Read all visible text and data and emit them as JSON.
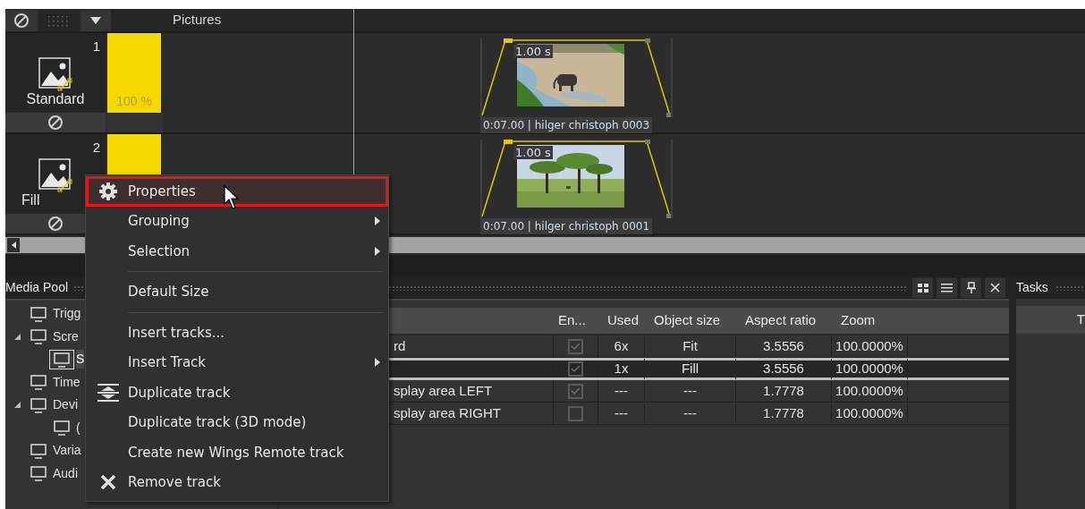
{
  "timeline": {
    "layer_name": "Pictures",
    "tracks": [
      {
        "number": "1",
        "mode": "Standard",
        "opacity": "100 %",
        "clip": {
          "fade": "1.00 s",
          "caption": "0:07.00 | hilger christoph 0003"
        }
      },
      {
        "number": "2",
        "mode": "Fill",
        "clip": {
          "fade": "1.00 s",
          "caption": "0:07.00 | hilger christoph 0001"
        }
      }
    ]
  },
  "media_pool": {
    "title": "Media Pool",
    "tree": [
      {
        "label": "Trigg",
        "selected": false
      },
      {
        "label": "Scre",
        "selected": false,
        "expanded": true,
        "children": [
          {
            "label": "S",
            "selected": true
          }
        ]
      },
      {
        "label": "Time",
        "selected": false
      },
      {
        "label": "Devi",
        "selected": false,
        "expanded": true,
        "children": [
          {
            "label": "(",
            "selected": false
          }
        ]
      },
      {
        "label": "Varia",
        "selected": false
      },
      {
        "label": "Audi",
        "selected": false
      }
    ],
    "table": {
      "columns": [
        "En...",
        "Used",
        "Object size",
        "Aspect ratio",
        "Zoom"
      ],
      "rows": [
        {
          "name": "rd",
          "enabled": true,
          "used": "6x",
          "object_size": "Fit",
          "aspect_ratio": "3.5556",
          "zoom": "100.0000%",
          "selected": false
        },
        {
          "enabled": true,
          "used": "1x",
          "object_size": "Fill",
          "aspect_ratio": "3.5556",
          "zoom": "100.0000%",
          "selected": true
        },
        {
          "name": "splay area LEFT",
          "enabled": true,
          "used": "---",
          "object_size": "---",
          "aspect_ratio": "1.7778",
          "zoom": "100.0000%",
          "selected": false
        },
        {
          "name": "splay area RIGHT",
          "enabled": false,
          "used": "---",
          "object_size": "---",
          "aspect_ratio": "1.7778",
          "zoom": "100.0000%",
          "selected": false
        }
      ]
    }
  },
  "tasks": {
    "title": "Tasks",
    "column_1": "T"
  },
  "context_menu": {
    "items": [
      {
        "kind": "item",
        "label": "Properties",
        "submenu": false,
        "selected": true
      },
      {
        "kind": "item",
        "label": "Grouping",
        "submenu": true,
        "selected": false
      },
      {
        "kind": "item",
        "label": "Selection",
        "submenu": true,
        "selected": false
      },
      {
        "kind": "separator"
      },
      {
        "kind": "item",
        "label": "Default Size",
        "submenu": false,
        "selected": false
      },
      {
        "kind": "separator"
      },
      {
        "kind": "item",
        "label": "Insert tracks...",
        "submenu": false,
        "selected": false
      },
      {
        "kind": "item",
        "label": "Insert Track",
        "submenu": true,
        "selected": false
      },
      {
        "kind": "item",
        "label": "Duplicate track",
        "submenu": false,
        "selected": false
      },
      {
        "kind": "item",
        "label": "Duplicate track (3D mode)",
        "submenu": false,
        "selected": false
      },
      {
        "kind": "item",
        "label": "Create new Wings Remote track",
        "submenu": false,
        "selected": false
      },
      {
        "kind": "item",
        "label": "Remove track",
        "submenu": false,
        "selected": false
      }
    ]
  }
}
